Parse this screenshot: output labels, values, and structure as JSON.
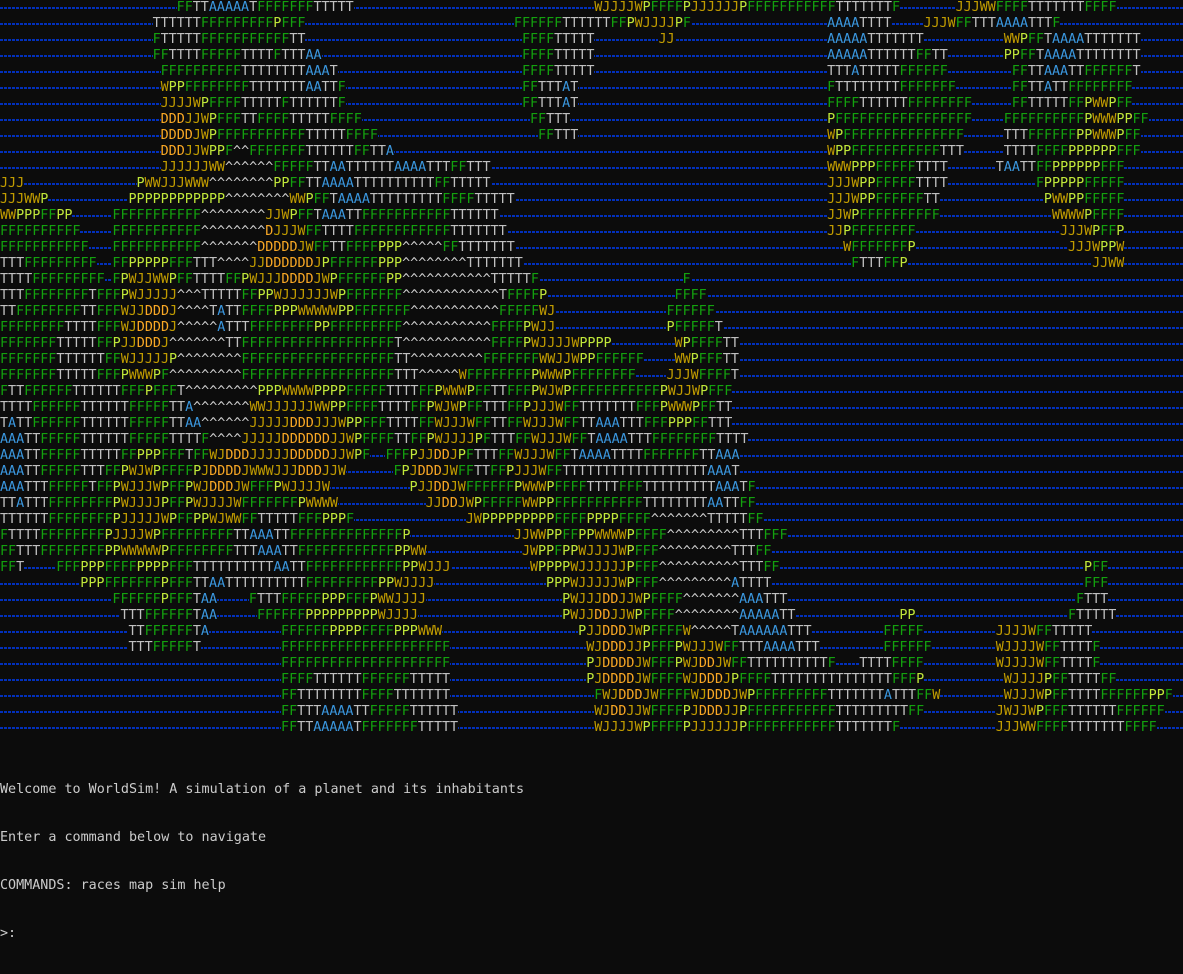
{
  "app": {
    "title": "WorldSim"
  },
  "colors": {
    "background": "#0c0c0c",
    "ocean": "#0037da",
    "terrain": {
      "T": "#c0c0c0",
      "F": "#13a10e",
      "P": "#c1e83a",
      "A": "#3a96dd",
      "W": "#c19c00",
      "J": "#c19c00",
      "D": "#f9a825",
      "^": "#cccccc"
    },
    "console_text": "#cccccc"
  },
  "map": {
    "rows": [
      [
        [
          22,
          "FFTTAAAAATFFFFFFFTTTTT"
        ],
        [
          74,
          "WJJJJWPFFFFPJJJJJJPFFFFFFFFFFFTTTTTTTF"
        ],
        [
          119,
          "JJJWWFFFFTTTTTTTFFFF"
        ]
      ],
      [
        [
          19,
          "TTTTTTFFFFFFFFFPFFF"
        ],
        [
          64,
          "FFFFFFTTTTTTFFPWJJJJPF"
        ],
        [
          103,
          "AAAATTTT"
        ],
        [
          115,
          "JJJWFFTTTAAAATTTF"
        ]
      ],
      [
        [
          19,
          "FTTTTTFFFFFFFFFFFTT"
        ],
        [
          65,
          "FFFFTTTTT"
        ],
        [
          82,
          "JJ"
        ],
        [
          103,
          "AAAAATTTTTTT"
        ],
        [
          125,
          "WWPFFTAAAATTTTTTT"
        ]
      ],
      [
        [
          19,
          "FFTTTTFFFFFTTTTFTTTAA"
        ],
        [
          65,
          "FFFFTTTTT"
        ],
        [
          103,
          "AAAAATTTTTTFFTT"
        ],
        [
          125,
          "PPFFTAAAATTTTTTTT"
        ]
      ],
      [
        [
          20,
          "FFFFFFFFFFTTTTTTTTAAAT"
        ],
        [
          65,
          "FFFFTTTTT"
        ],
        [
          103,
          "TTTATTTTTFFFFFF"
        ],
        [
          126,
          "FFTTAAATTFFFFFFT"
        ]
      ],
      [
        [
          20,
          "WPPFFFFFFFFTTTTTTTAATTF"
        ],
        [
          65,
          "FFTTTAT"
        ],
        [
          103,
          "FTTTTTTTTFFFFFFF"
        ],
        [
          126,
          "FFTTATTFFFFFFFF"
        ]
      ],
      [
        [
          20,
          "JJJJWPFFFFTTTTTFTTTTTTF"
        ],
        [
          65,
          "FFTTTAT"
        ],
        [
          103,
          "FFFFTTTTTTFFFFFFFF"
        ],
        [
          126,
          "FFTTTTTFFPWWPFF"
        ]
      ],
      [
        [
          20,
          "DDDJJWPFFFTTFFFFTTTTTFFFF"
        ],
        [
          66,
          "FFTTT"
        ],
        [
          103,
          "PFFFFFFFFFFFFFFFFF"
        ],
        [
          125,
          "FFFFFFFFFFPWWWPPFF"
        ]
      ],
      [
        [
          20,
          "DDDDJWPFFFFFFFFFFFTTTTTFFFF"
        ],
        [
          67,
          "FFTTT"
        ],
        [
          103,
          "WPFFFFFFFFFFFFFFF"
        ],
        [
          125,
          "TTTFFFFFFPPWWWPFF"
        ]
      ],
      [
        [
          20,
          "DDDJJWPPF^^FFFFFFFTTTTTTFFTTA"
        ],
        [
          103,
          "WPPFFFFFFFFFFFTTT"
        ],
        [
          125,
          "TTTTFFFFPPPPPPFFF"
        ]
      ],
      [
        [
          20,
          "JJJJJJWW^^^^^^FFFFFTTAATTTTTTAAAATTTFFTTT"
        ],
        [
          103,
          "WWWPPPFFFFFTTTT"
        ],
        [
          124,
          "TAATTFFPPPPPPFFF"
        ]
      ],
      [
        [
          0,
          "JJJ"
        ],
        [
          17,
          "PWWJJJWWW^^^^^^^^PPFFTTAAAATTTTTTTTTTFFTTTTT"
        ],
        [
          103,
          "JJJWPPFFFFFTTTT"
        ],
        [
          129,
          "FPPPPPFFFFF"
        ]
      ],
      [
        [
          0,
          "JJJWWP"
        ],
        [
          16,
          "PPPPPPPPPPPP^^^^^^^^WWPFFTAAAATTTTTTTTTFFFFTTTTT"
        ],
        [
          103,
          "JJJWPPFFFFFFTT"
        ],
        [
          130,
          "PWWPPFFFFF"
        ]
      ],
      [
        [
          0,
          "WWPPPFFPP"
        ],
        [
          14,
          "FFFFFFFFFFF^^^^^^^^JJWPFFTAAATTFFFFFFFFFFFTTTTTT"
        ],
        [
          103,
          "JJWPFFFFFFFFFF"
        ],
        [
          131,
          "WWWWPFFFF"
        ]
      ],
      [
        [
          0,
          "FFFFFFFFFF"
        ],
        [
          14,
          "FFFFFFFFFFF^^^^^^^^DJJJWFFTTTTFFFFFFFFFFFFTTTTTTT"
        ],
        [
          103,
          "JJPFFFFFFFF"
        ],
        [
          132,
          "JJJWPFFP"
        ]
      ],
      [
        [
          0,
          "FFFFFFFFFFF"
        ],
        [
          14,
          "FFFFFFFFFFF^^^^^^^DDDDDJWFFTTFFFFPPP^^^^^FFTTTTTTT"
        ],
        [
          105,
          "WFFFFFFFP"
        ],
        [
          133,
          "JJJWPPW"
        ]
      ],
      [
        [
          0,
          "TTTFFFFFFFFF"
        ],
        [
          14,
          "FFPPPPPFFFTTT^^^^JJDDDDDDJPFFFFFFPPP^^^^^^^^TTTTTTT"
        ],
        [
          106,
          "FTTTFFP"
        ],
        [
          136,
          "JJWW"
        ]
      ],
      [
        [
          0,
          "TTTTFFFFFFFFF"
        ],
        [
          14,
          "FPWJJWWPFFTTTTFFPWJJJDDDDJWPFFFFFFPP^^^^^^^^^^^TTTTTF"
        ],
        [
          85,
          "F"
        ]
      ],
      [
        [
          0,
          "TTTFFFFFFFFTFFFPWJJJJJ^^^TTTTTFFPPWJJJJJJWPFFFFFFF^^^^^^^^^^^^TFFFFP"
        ],
        [
          84,
          "FFFF"
        ]
      ],
      [
        [
          0,
          "TTFFFFFFFFTTFFFWJJDDDJ^^^^TATTFFFFPPPWWWWWPPFFFFFFF^^^^^^^^^^^FFFFFWJ"
        ],
        [
          83,
          "FFFFFF"
        ]
      ],
      [
        [
          0,
          "FFFFFFFFTTTTFFFWJDDDDJ^^^^^ATTTFFFFFFFFPPFFFFFFFFF^^^^^^^^^^^FFFFPWJJ"
        ],
        [
          83,
          "PFFFFFT"
        ]
      ],
      [
        [
          0,
          "FFFFFFFTTTTTFFPJJDDDJ^^^^^^^TTFFFFFFFFFFFFFFFFFFFT^^^^^^^^^^^FFFFPWJJJJWPPPP"
        ],
        [
          84,
          "WPFFFFTT"
        ]
      ],
      [
        [
          0,
          "FFFFFFFTTTTTTFFWJJJJJP^^^^^^^^FFFFFFFFFFFFFFFFFFFTT^^^^^^^^^FFFFFFFWWJJWPPFFFFFF"
        ],
        [
          84,
          "WWPFFFTT"
        ]
      ],
      [
        [
          0,
          "FFFFFFFTTTTTFFFPWWWPF^^^^^^^^^FFFFFFFFFFFFFFFFFFFTTT^^^^^WFFFFFFFFPWWWPFFFFFFFF"
        ],
        [
          83,
          "JJJWFFFFT"
        ]
      ],
      [
        [
          0,
          "FTTFFFFFFTTTTTTFFFPFFFT^^^^^^^^^PPPWWWWPPPPFFFFFTTTTFFPWWWPFFTTFFFPWJWPFFFFFFFFFFFPWJJWPFFF"
        ]
      ],
      [
        [
          0,
          "TTTTFFFFFFTTTTTTFFFFFTTA^^^^^^^WWJJJJJJWWPPFFFFTTTTFFPWJWPFFTTTFFPJJJWFFTTTTTTTFFFPWWWPFFTT"
        ]
      ],
      [
        [
          0,
          "TATTFFFFFFTTTTTTFFFFFTTAA^^^^^^JJJJJDDDJJJWPPFFFTTTTFFWJJJWFFTTFFWJJJWFFTTAAATTTFFFPPPFFTTT"
        ]
      ],
      [
        [
          0,
          "AAATTFFFFFTTTTTTFFFFFTTTTF^^^^JJJJJDDDDDDJJWPFFFFTTFFPWJJJJPFTTTFFWJJJWFFTAAAATTTFFFFFFFFTTTT"
        ]
      ],
      [
        [
          0,
          "AAATTFFFFFTTTTTFFPPPFFFTFFWJDDDJJJJJDDDDDJJWPF"
        ],
        [
          48,
          "FFFPJJDDJPFTTTFFWJJJWFFTAAAATTTTFFFFFFFTTAAA"
        ]
      ],
      [
        [
          0,
          "AAATTFFFFFTTTFFPWJWPFFFFPJDDDDJWWWJJJDDDJJW"
        ],
        [
          49,
          "FPJDDDJWFFTTFFPJJJWFFTTTTTTTTTTTTTTTTTTAAAT"
        ]
      ],
      [
        [
          0,
          "AAATTTFFFFFTFFPWJJJWPFFPWJDDDJWFFFPWJJJJW"
        ],
        [
          51,
          "PJJDDJWFFFFFFPWWWPFFFFTTTTFFFTTTTTTTTTAAATF"
        ]
      ],
      [
        [
          0,
          "TTATTTFFFFFFFFPWJJJJPFFPWJJJJWFFFFFFFPWWWW"
        ],
        [
          53,
          "JJDDJWPFFFFFWWPPFFFFFFFFFFFTTTTTTTTAATTFF"
        ]
      ],
      [
        [
          0,
          "TTTTTTFFFFFFFFPJJJJJWPFFPPWJWWFFTTTTTFFFPPPF"
        ],
        [
          58,
          "JWPPPPPPPPPFFFFPPPPFFFF^^^^^^^TTTTTFF"
        ]
      ],
      [
        [
          0,
          "FTTTTFFFFFFFFPJJJJWPFFFFFFFFFTTAAATTFFFFFFFFFFFFFFP"
        ],
        [
          64,
          "JJWWPPFFPPWWWWPFFFF^^^^^^^^^TTTFFF"
        ]
      ],
      [
        [
          0,
          "FFTTTFFFFFFFFPPWWWWWPFFFFFFFFTTTAAATTFFFFFFFFFFFFPPWW"
        ],
        [
          65,
          "JWPPFPPWJJJJWPFFF^^^^^^^^^TTTFF"
        ]
      ],
      [
        [
          0,
          "FFT"
        ],
        [
          7,
          "FFFPPPFFFFPPPPFFFTTTTTTTTTTAATTFFFFFFFFFFFFPPWJJJ"
        ],
        [
          66,
          "WPPPPWJJJJJJPFFF^^^^^^^^^^TTTFF"
        ],
        [
          135,
          "PFF"
        ]
      ],
      [
        [
          10,
          "PPPFFFFFFFPFFFTTAATTTTTTTTTTFFFFFFFFFPPWJJJJ"
        ],
        [
          68,
          "PPPWJJJJJWPFFF^^^^^^^^^ATTTT"
        ],
        [
          135,
          "FFF"
        ]
      ],
      [
        [
          14,
          "FFFFFFPFFFTAA"
        ],
        [
          31,
          "FTTTFFFFFPPPFFFPWWJJJJ"
        ],
        [
          70,
          "PWJJJDDJJWPFFFF^^^^^^^AAATTT"
        ],
        [
          134,
          "FTTT"
        ]
      ],
      [
        [
          15,
          "TTTFFFFFFTAA"
        ],
        [
          32,
          "FFFFFFPPPPPPPPPWJJJJ"
        ],
        [
          70,
          "PWJJDDJJWPFFFF^^^^^^^^AAAAATT"
        ],
        [
          112,
          "PP"
        ],
        [
          133,
          "FTTTTT"
        ]
      ],
      [
        [
          16,
          "TTFFFFFFTA"
        ],
        [
          35,
          "FFFFFFPPPPFFFFPPPWWW"
        ],
        [
          72,
          "PJJDDDJWPFFFFW^^^^^TAAAAAATTT"
        ],
        [
          110,
          "FFFFF"
        ],
        [
          124,
          "JJJJWFFTTTTT"
        ]
      ],
      [
        [
          16,
          "TTTFFFFFT"
        ],
        [
          35,
          "FFFFFFFFFFFFFFFFFFFFF"
        ],
        [
          73,
          "WJDDDJJPFFFPWJJJWFFTTTAAAATTT"
        ],
        [
          110,
          "FFFFFF"
        ],
        [
          124,
          "WJJJJWFFTTTTF"
        ]
      ],
      [
        [
          35,
          "FFFFFFFFFFFFFFFFFFFFF"
        ],
        [
          73,
          "PJDDDDJWFFFPWJDDJWFFTTTTTTTTTTF"
        ],
        [
          107,
          "TTTTFFFF"
        ],
        [
          124,
          "WJJJJWFFTTTTF"
        ]
      ],
      [
        [
          35,
          "FFFFTTTTTTFFFFFFTTTTT"
        ],
        [
          73,
          "PJDDDDJWFFFFWJDDDJPFFFFTTTTTTTTTTTTTTTFFFP"
        ],
        [
          125,
          "WJJJJPFFTTTTFF"
        ]
      ],
      [
        [
          35,
          "FFTTTTTTTTFFFFTTTTTTT"
        ],
        [
          74,
          "FWJDDDJWFFFFWJDDDJWPFFFFFFFFFTTTTTTTATTTFFW"
        ],
        [
          125,
          "WJJJWPFFTTTTFFFFFFPPF"
        ]
      ],
      [
        [
          35,
          "FFTTTAAAATTFFFFFTTTTTT"
        ],
        [
          74,
          "WJDDJJWFFFFPJDDDJJPFFFFFFFFFFFTTTTTTTTTFF"
        ],
        [
          124,
          "JWJJWPFFFTTTTTTFFFFFF"
        ]
      ],
      [
        [
          35,
          "FFTTAAAAATFFFFFFFTTTTT"
        ],
        [
          74,
          "WJJJJWPFFFFPJJJJJJPFFFFFFFFFFFTTTTTTTF"
        ],
        [
          124,
          "JJJWWFFFFTTTTTTTFFFF"
        ]
      ]
    ]
  },
  "console": {
    "welcome_line": "Welcome to WorldSim! A simulation of a planet and its inhabitants",
    "instruction_line": "Enter a command below to navigate",
    "commands_line": "COMMANDS: races map sim help",
    "prompt": ">:"
  }
}
